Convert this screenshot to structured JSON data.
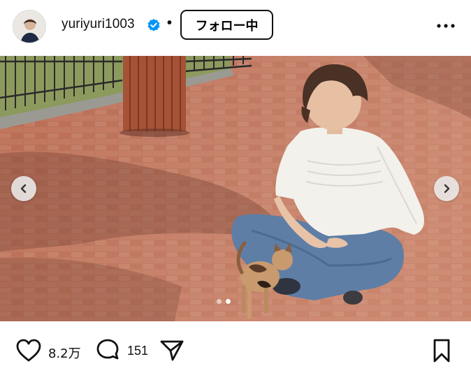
{
  "header": {
    "username": "yuriyuri1003",
    "verified": true,
    "separator": "•",
    "follow_label": "フォロー中"
  },
  "post": {
    "carousel_dots": 2,
    "active_dot": 2
  },
  "actions": {
    "likes": "8.2万",
    "comments": "151"
  },
  "colors": {
    "verified_blue": "#0095f6",
    "text": "#111111"
  },
  "icons": {
    "more": "more-horizontal-icon",
    "like": "heart-icon",
    "comment": "comment-icon",
    "share": "share-icon",
    "save": "bookmark-icon",
    "prev": "chevron-left-icon",
    "next": "chevron-right-icon"
  }
}
